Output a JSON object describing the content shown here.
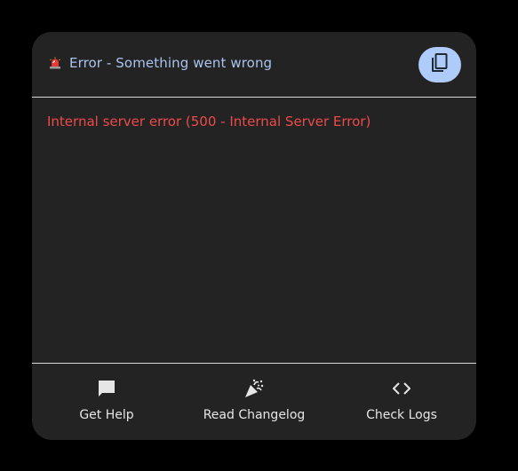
{
  "dialog": {
    "title": "Error - Something went wrong",
    "title_icon": "siren-icon",
    "copy_icon": "copy-icon",
    "message": "Internal server error (500 - Internal Server Error)"
  },
  "actions": [
    {
      "label": "Get Help",
      "icon": "chat-icon"
    },
    {
      "label": "Read Changelog",
      "icon": "party-popper-icon"
    },
    {
      "label": "Check Logs",
      "icon": "code-icon"
    }
  ],
  "colors": {
    "background": "#000000",
    "card": "#232323",
    "title": "#aac4ef",
    "error": "#ef4a4a",
    "accent": "#aecbfa",
    "text": "#e6e6e6"
  }
}
